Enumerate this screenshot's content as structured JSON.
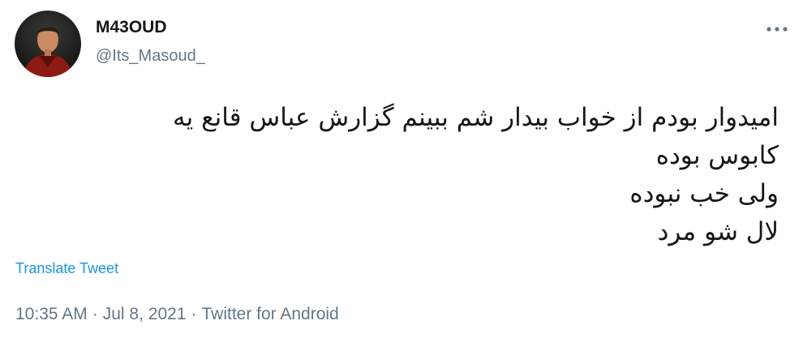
{
  "user": {
    "display_name": "M43OUD",
    "username": "@Its_Masoud_"
  },
  "tweet": {
    "lines": [
      "امیدوار بودم از خواب بیدار شم ببینم گزارش عباس قانع یه",
      "کابوس بوده",
      "ولی خب نبوده",
      "لال شو مرد"
    ],
    "translate_label": "Translate Tweet"
  },
  "meta": {
    "time": "10:35 AM",
    "date": "Jul 8, 2021",
    "source": "Twitter for Android",
    "separator": "·"
  },
  "icons": {
    "avatar": "profile-photo",
    "more": "more-options-icon"
  },
  "colors": {
    "link": "#1b95e0",
    "secondary_text": "#657786",
    "primary_text": "#14171a"
  }
}
